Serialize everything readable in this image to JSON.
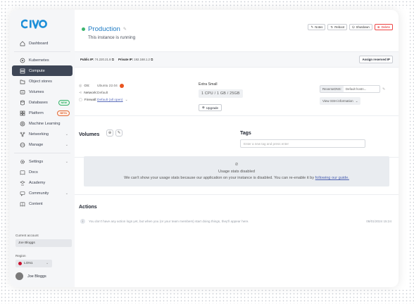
{
  "sidebar": {
    "logo": "CIVO",
    "items": [
      {
        "label": "Dashboard"
      },
      {
        "label": "Kubernetes"
      },
      {
        "label": "Compute"
      },
      {
        "label": "Object stores"
      },
      {
        "label": "Volumes"
      },
      {
        "label": "Databases",
        "badge": "NEW"
      },
      {
        "label": "Platform",
        "badge": "BETA"
      },
      {
        "label": "Machine Learning"
      },
      {
        "label": "Networking"
      },
      {
        "label": "Manage"
      },
      {
        "label": "Settings"
      },
      {
        "label": "Docs"
      },
      {
        "label": "Academy"
      },
      {
        "label": "Community"
      },
      {
        "label": "Content"
      }
    ],
    "account_label": "Current account",
    "account_value": "Joe Bloggs",
    "region_label": "Region",
    "region_value": "LON1",
    "user_name": "Joe Bloggs"
  },
  "header": {
    "title": "Production",
    "subtitle": "This instance is running",
    "buttons": {
      "notes": "Notes",
      "reboot": "Reboot",
      "shutdown": "Shutdown",
      "delete": "Delete"
    }
  },
  "ipbar": {
    "public_label": "Public IP:",
    "public_value": "74.220.21.8",
    "private_label": "Private IP:",
    "private_value": "192.168.1.2",
    "assign": "Assign reserved IP"
  },
  "spec": {
    "os_label": "OS:",
    "os_value": "Ubuntu 22.04",
    "network_label": "Network:",
    "network_value": "Default",
    "firewall_label": "Firewall:",
    "firewall_value": "Default (all open)",
    "size_name": "Extra Small",
    "size_detail": "1 CPU / 1 GB / 25GB",
    "upgrade": "Upgrade",
    "rdns_label": "ReverseDNS:",
    "rdns_value": "Default hostn...",
    "ssh": "View SSH information"
  },
  "volumes": {
    "title": "Volumes",
    "tags_title": "Tags",
    "tags_placeholder": "Enter a new tag and press enter"
  },
  "usage": {
    "title": "Usage stats disabled",
    "message": "We can't show your usage stats because our application on your instance is disabled. You can re-enable it by",
    "link": "following our guide."
  },
  "actions": {
    "title": "Actions",
    "empty": "You don't have any action logs yet, but when you (or your team members) start doing things, they'll appear here.",
    "date": "08/01/2024 15:24"
  },
  "colors": {
    "accent": "#1e7bc4",
    "running": "#3cb46e",
    "active_nav": "#3e4656",
    "delete": "#dd2222"
  }
}
